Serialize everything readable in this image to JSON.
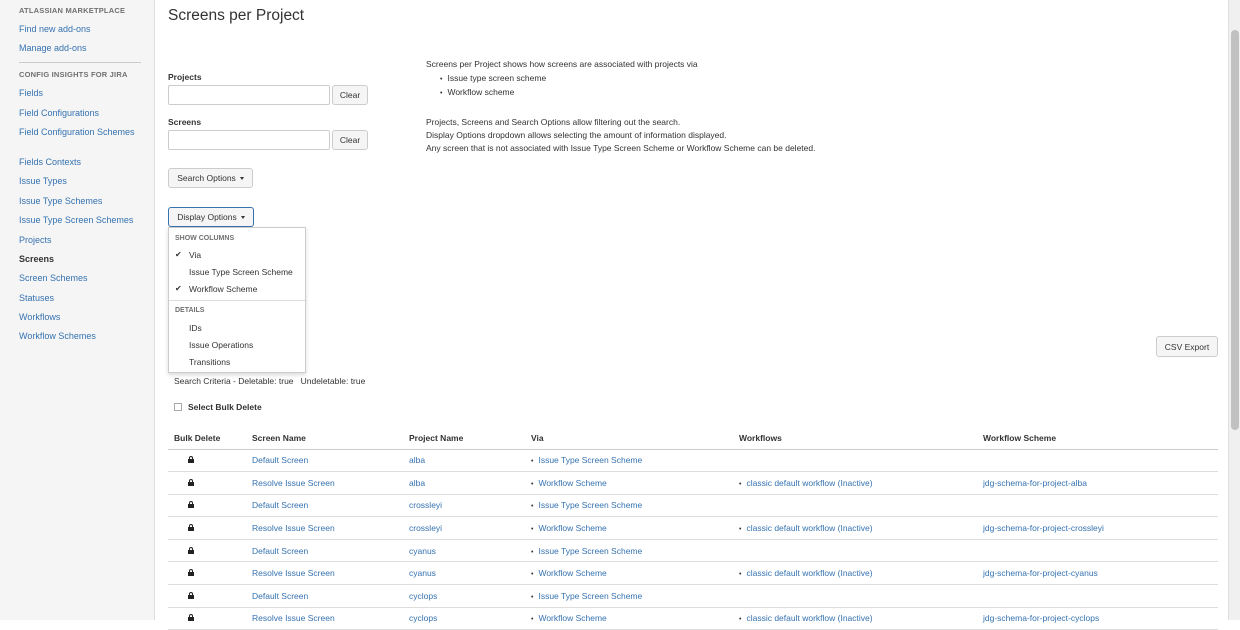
{
  "sidebar": {
    "marketplace_heading": "ATLASSIAN MARKETPLACE",
    "marketplace_links": [
      "Find new add-ons",
      "Manage add-ons"
    ],
    "config_heading": "CONFIG INSIGHTS FOR JIRA",
    "items": [
      {
        "label": "Fields",
        "active": false
      },
      {
        "label": "Field Configurations",
        "active": false
      },
      {
        "label": "Field Configuration Schemes",
        "active": false
      },
      {
        "label": "Fields Contexts",
        "active": false
      },
      {
        "label": "Issue Types",
        "active": false
      },
      {
        "label": "Issue Type Schemes",
        "active": false
      },
      {
        "label": "Issue Type Screen Schemes",
        "active": false
      },
      {
        "label": "Projects",
        "active": false
      },
      {
        "label": "Screens",
        "active": true
      },
      {
        "label": "Screen Schemes",
        "active": false
      },
      {
        "label": "Statuses",
        "active": false
      },
      {
        "label": "Workflows",
        "active": false
      },
      {
        "label": "Workflow Schemes",
        "active": false
      }
    ]
  },
  "main": {
    "title": "Screens per Project",
    "projects_label": "Projects",
    "screens_label": "Screens",
    "clear_label": "Clear",
    "search_options_label": "Search Options",
    "display_options_label": "Display Options",
    "csv_export_label": "CSV Export",
    "info": {
      "line1": "Screens per Project shows how screens are associated with projects via",
      "bullets": [
        "Issue type screen scheme",
        "Workflow scheme"
      ],
      "line2": "Projects, Screens and Search Options allow filtering out the search.",
      "line3": "Display Options dropdown allows selecting the amount of information displayed.",
      "line4": "Any screen that is not associated with Issue Type Screen Scheme or Workflow Scheme can be deleted."
    },
    "criteria": "Search Criteria - Deletable: true   Undeletable: true",
    "bulk_delete_label": "Select Bulk Delete"
  },
  "dropdown": {
    "show_columns_heading": "SHOW COLUMNS",
    "columns": [
      {
        "label": "Via",
        "checked": true
      },
      {
        "label": "Issue Type Screen Scheme",
        "checked": false
      },
      {
        "label": "Workflow Scheme",
        "checked": true
      }
    ],
    "details_heading": "DETAILS",
    "details": [
      "IDs",
      "Issue Operations",
      "Transitions"
    ]
  },
  "table": {
    "headers": [
      "Bulk Delete",
      "Screen Name",
      "Project Name",
      "Via",
      "Workflows",
      "Workflow Scheme"
    ],
    "rows": [
      {
        "screen": "Default Screen",
        "project": "alba",
        "via": "Issue Type Screen Scheme",
        "workflow": "",
        "scheme": ""
      },
      {
        "screen": "Resolve Issue Screen",
        "project": "alba",
        "via": "Workflow Scheme",
        "workflow": "classic default workflow (Inactive)",
        "scheme": "jdg-schema-for-project-alba"
      },
      {
        "screen": "Default Screen",
        "project": "crossleyi",
        "via": "Issue Type Screen Scheme",
        "workflow": "",
        "scheme": ""
      },
      {
        "screen": "Resolve Issue Screen",
        "project": "crossleyi",
        "via": "Workflow Scheme",
        "workflow": "classic default workflow (Inactive)",
        "scheme": "jdg-schema-for-project-crossleyi"
      },
      {
        "screen": "Default Screen",
        "project": "cyanus",
        "via": "Issue Type Screen Scheme",
        "workflow": "",
        "scheme": ""
      },
      {
        "screen": "Resolve Issue Screen",
        "project": "cyanus",
        "via": "Workflow Scheme",
        "workflow": "classic default workflow (Inactive)",
        "scheme": "jdg-schema-for-project-cyanus"
      },
      {
        "screen": "Default Screen",
        "project": "cyclops",
        "via": "Issue Type Screen Scheme",
        "workflow": "",
        "scheme": ""
      },
      {
        "screen": "Resolve Issue Screen",
        "project": "cyclops",
        "via": "Workflow Scheme",
        "workflow": "classic default workflow (Inactive)",
        "scheme": "jdg-schema-for-project-cyclops"
      }
    ]
  },
  "colors": {
    "link": "#3572b0",
    "text": "#333333",
    "sidebar_bg": "#f5f5f5"
  }
}
